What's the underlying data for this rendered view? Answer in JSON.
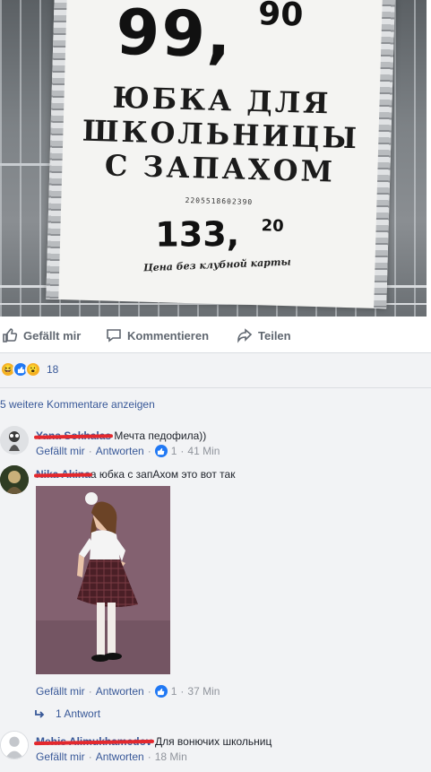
{
  "post": {
    "photo": {
      "price_main": "99,",
      "price_cents": "90",
      "title_lines": [
        "ЮБКА ДЛЯ",
        "ШКОЛЬНИЦЫ",
        "С ЗАПАХОМ"
      ],
      "barcode": "2205518602390",
      "card_price_main": "133,",
      "card_price_cents": "20",
      "card_note": "Цена без клубной карты"
    },
    "actions": {
      "like": "Gefällt mir",
      "comment": "Kommentieren",
      "share": "Teilen"
    },
    "reactions": {
      "count": "18",
      "icons": [
        "haha-icon",
        "like-icon",
        "wow-icon"
      ]
    },
    "more_comments": "5 weitere Kommentare anzeigen"
  },
  "comments": [
    {
      "author": "Yana Sokhalas",
      "text": "Мечта педофила))",
      "meta": {
        "like": "Gefällt mir",
        "reply": "Antworten",
        "likes": "1",
        "time": "41 Min"
      }
    },
    {
      "author": "Nika Akina",
      "text": "а юбка с запАхом это вот так",
      "meta": {
        "like": "Gefällt mir",
        "reply": "Antworten",
        "likes": "1",
        "time": "37 Min"
      },
      "replies_label": "1 Antwort"
    },
    {
      "author": "Mehis Alimukhamedov",
      "text": "Для вонючих школьниц",
      "meta": {
        "like": "Gefällt mir",
        "reply": "Antworten",
        "time": "18 Min"
      }
    }
  ],
  "colors": {
    "link": "#385898",
    "meta": "#90949c",
    "action": "#606770",
    "redact": "#e4282d",
    "like_blue": "#2078f4"
  }
}
